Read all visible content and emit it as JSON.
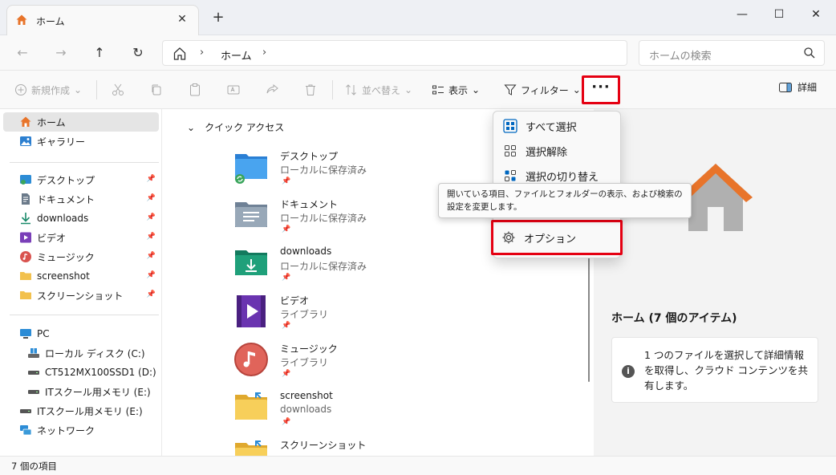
{
  "tab": {
    "title": "ホーム",
    "close": "✕",
    "new_tab": "+"
  },
  "window": {
    "minimize": "—",
    "maximize": "☐",
    "close": "✕"
  },
  "nav": {
    "back": "←",
    "forward": "→",
    "up": "↑",
    "refresh": "↻",
    "breadcrumb": "ホーム",
    "search_placeholder": "ホームの検索"
  },
  "toolbar": {
    "new": "新規作成",
    "sort": "並べ替え",
    "view": "表示",
    "filter": "フィルター",
    "more": "···",
    "details": "詳細"
  },
  "sidebar": {
    "home": "ホーム",
    "gallery": "ギャラリー",
    "pinned": [
      {
        "label": "デスクトップ",
        "icon": "desktop-icon",
        "color": "#2c8cd6"
      },
      {
        "label": "ドキュメント",
        "icon": "document-icon",
        "color": "#6b7a8a"
      },
      {
        "label": "downloads",
        "icon": "download-icon",
        "color": "#1a8a6a"
      },
      {
        "label": "ビデオ",
        "icon": "video-icon",
        "color": "#7a3fb8"
      },
      {
        "label": "ミュージック",
        "icon": "music-icon",
        "color": "#d9534f"
      },
      {
        "label": "screenshot",
        "icon": "folder-icon",
        "color": "#f2c14e"
      },
      {
        "label": "スクリーンショット",
        "icon": "folder-icon",
        "color": "#f2c14e"
      }
    ],
    "pc": "PC",
    "drives": [
      {
        "label": "ローカル ディスク (C:)"
      },
      {
        "label": "CT512MX100SSD1 (D:)"
      },
      {
        "label": "ITスクール用メモリ (E:)"
      }
    ],
    "usb": "ITスクール用メモリ (E:)",
    "network": "ネットワーク"
  },
  "main": {
    "section": "クイック アクセス",
    "folders": [
      {
        "name": "デスクトップ",
        "sub": "ローカルに保存済み",
        "icon": "desktop-folder-icon"
      },
      {
        "name": "ドキュメント",
        "sub": "ローカルに保存済み",
        "icon": "documents-folder-icon"
      },
      {
        "name": "downloads",
        "sub": "ローカルに保存済み",
        "icon": "downloads-folder-icon"
      },
      {
        "name": "ビデオ",
        "sub": "ライブラリ",
        "icon": "video-folder-icon"
      },
      {
        "name": "ミュージック",
        "sub": "ライブラリ",
        "icon": "music-folder-icon"
      },
      {
        "name": "screenshot",
        "sub": "downloads",
        "icon": "screenshot-folder-icon"
      },
      {
        "name": "スクリーンショット",
        "sub": "",
        "icon": "screenshot2-folder-icon"
      }
    ]
  },
  "menu": {
    "select_all": "すべて選択",
    "select_none": "選択解除",
    "invert": "選択の切り替え",
    "options": "オプション"
  },
  "tooltip": "開いている項目、ファイルとフォルダーの表示、および検索の設定を変更します。",
  "details_pane": {
    "title": "ホーム (7 個のアイテム)",
    "info": "1 つのファイルを選択して詳細情報を取得し、クラウド コンテンツを共有します。"
  },
  "status": {
    "count": "7 個の項目"
  },
  "colors": {
    "highlight": "#e50012",
    "accent": "#0067c0",
    "home_orange": "#e8742a"
  }
}
